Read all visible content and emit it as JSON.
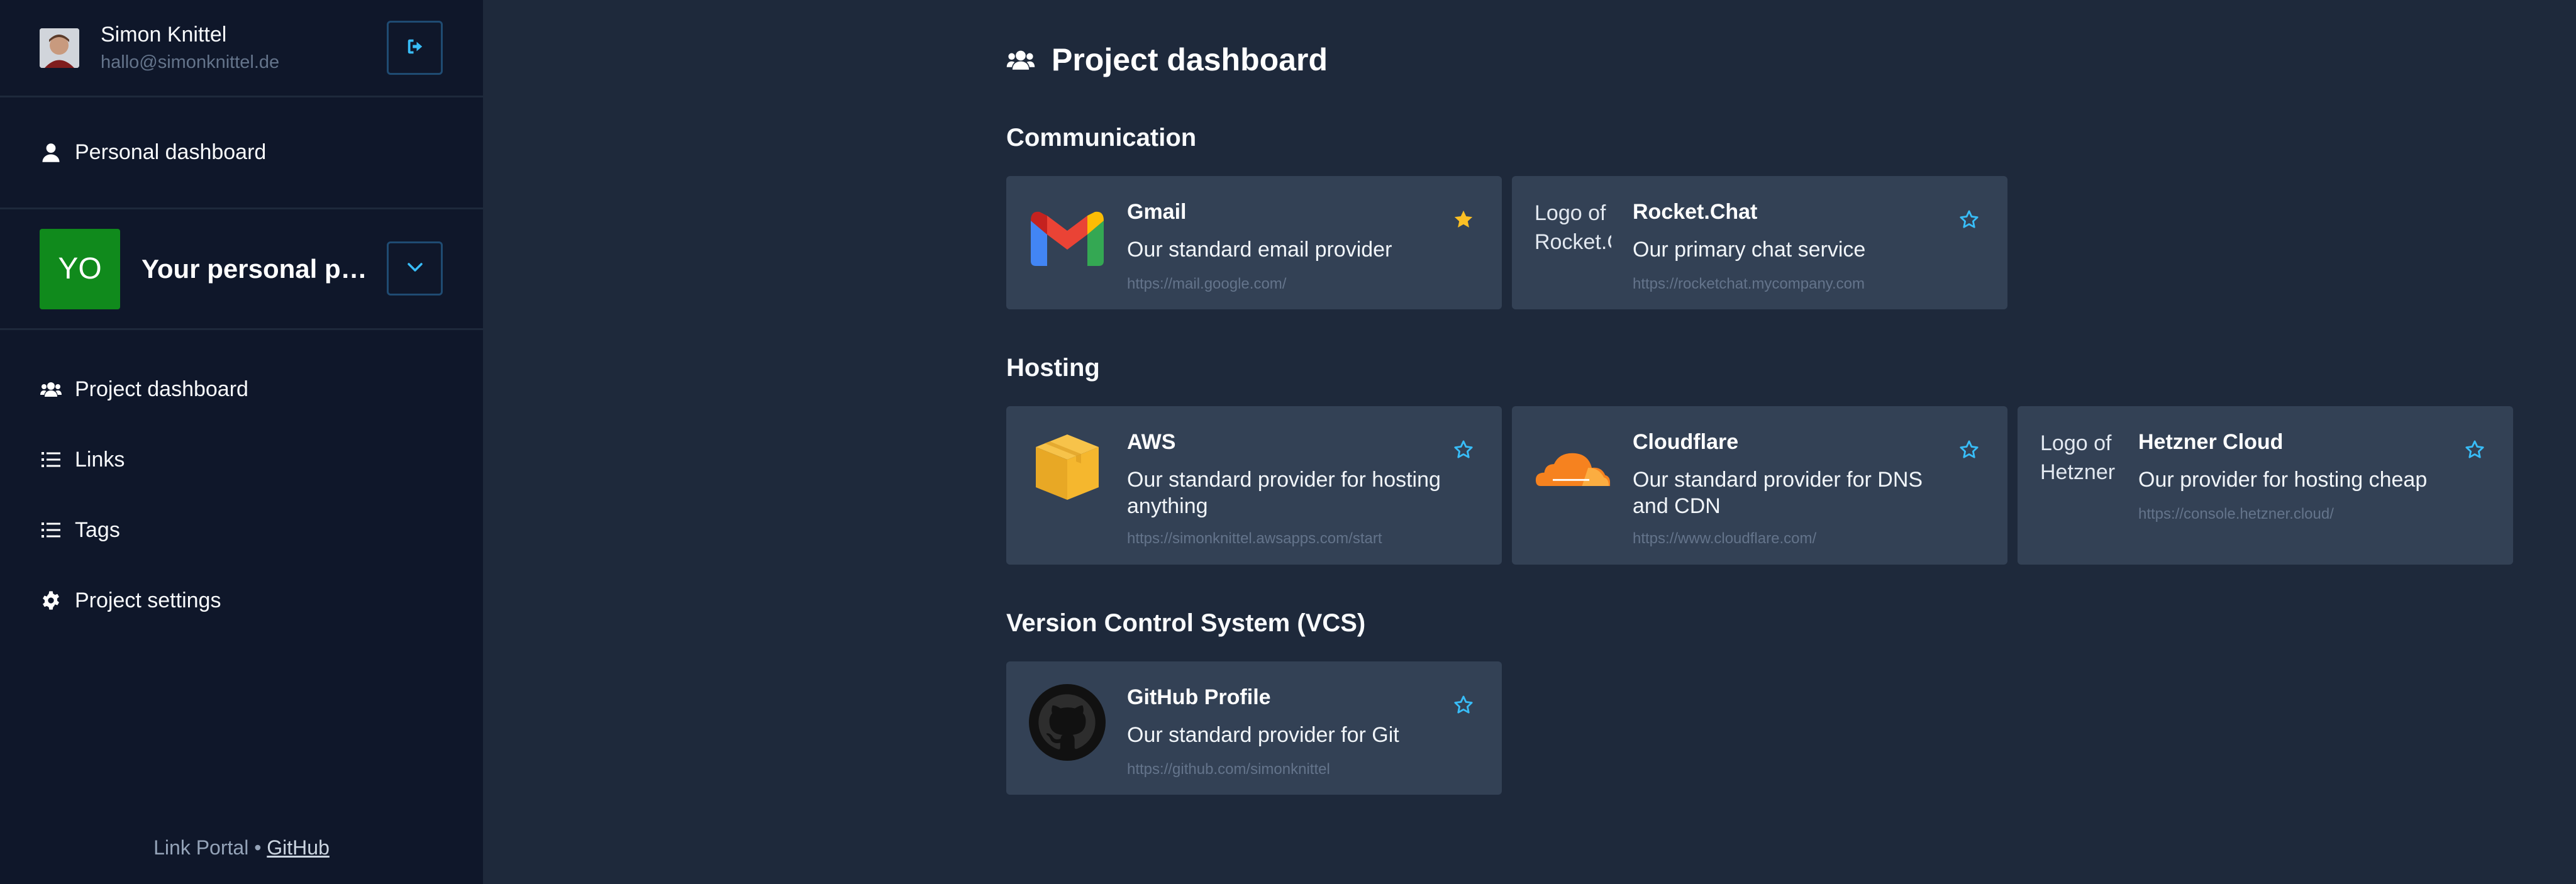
{
  "user": {
    "name": "Simon Knittel",
    "email": "hallo@simonknittel.de"
  },
  "nav_personal": {
    "label": "Personal dashboard"
  },
  "project": {
    "initials": "YO",
    "name": "Your personal pr..."
  },
  "nav": [
    {
      "label": "Project dashboard",
      "icon": "users-icon"
    },
    {
      "label": "Links",
      "icon": "list-icon"
    },
    {
      "label": "Tags",
      "icon": "list-icon"
    },
    {
      "label": "Project settings",
      "icon": "gear-icon"
    }
  ],
  "footer": {
    "text": "Link Portal •",
    "link": "GitHub"
  },
  "page": {
    "title": "Project dashboard"
  },
  "colors": {
    "accent": "#38bdf8",
    "star_active": "#fbbf24",
    "card_bg": "#334155",
    "sidebar_bg": "#0f172a",
    "main_bg": "#1e293b",
    "project_avatar": "#108a1c"
  },
  "sections": [
    {
      "title": "Communication",
      "cards": [
        {
          "title": "Gmail",
          "description": "Our standard email provider",
          "url": "https://mail.google.com/",
          "favorite": true,
          "logo": "gmail-logo"
        },
        {
          "title": "Rocket.Chat",
          "description": "Our primary chat service",
          "url": "https://rocketchat.mycompany.com",
          "favorite": false,
          "logo_alt": "Logo of Rocket.C"
        }
      ]
    },
    {
      "title": "Hosting",
      "cards": [
        {
          "title": "AWS",
          "description": "Our standard provider for hosting anything",
          "url": "https://simonknittel.awsapps.com/start",
          "favorite": false,
          "logo": "aws-logo"
        },
        {
          "title": "Cloudflare",
          "description": "Our standard provider for DNS and CDN",
          "url": "https://www.cloudflare.com/",
          "favorite": false,
          "logo": "cloudflare-logo"
        },
        {
          "title": "Hetzner Cloud",
          "description": "Our provider for hosting cheap",
          "url": "https://console.hetzner.cloud/",
          "favorite": false,
          "logo_alt": "Logo of Hetzner"
        }
      ]
    },
    {
      "title": "Version Control System (VCS)",
      "cards": [
        {
          "title": "GitHub Profile",
          "description": "Our standard provider for Git",
          "url": "https://github.com/simonknittel",
          "favorite": false,
          "logo": "github-logo"
        }
      ]
    }
  ]
}
